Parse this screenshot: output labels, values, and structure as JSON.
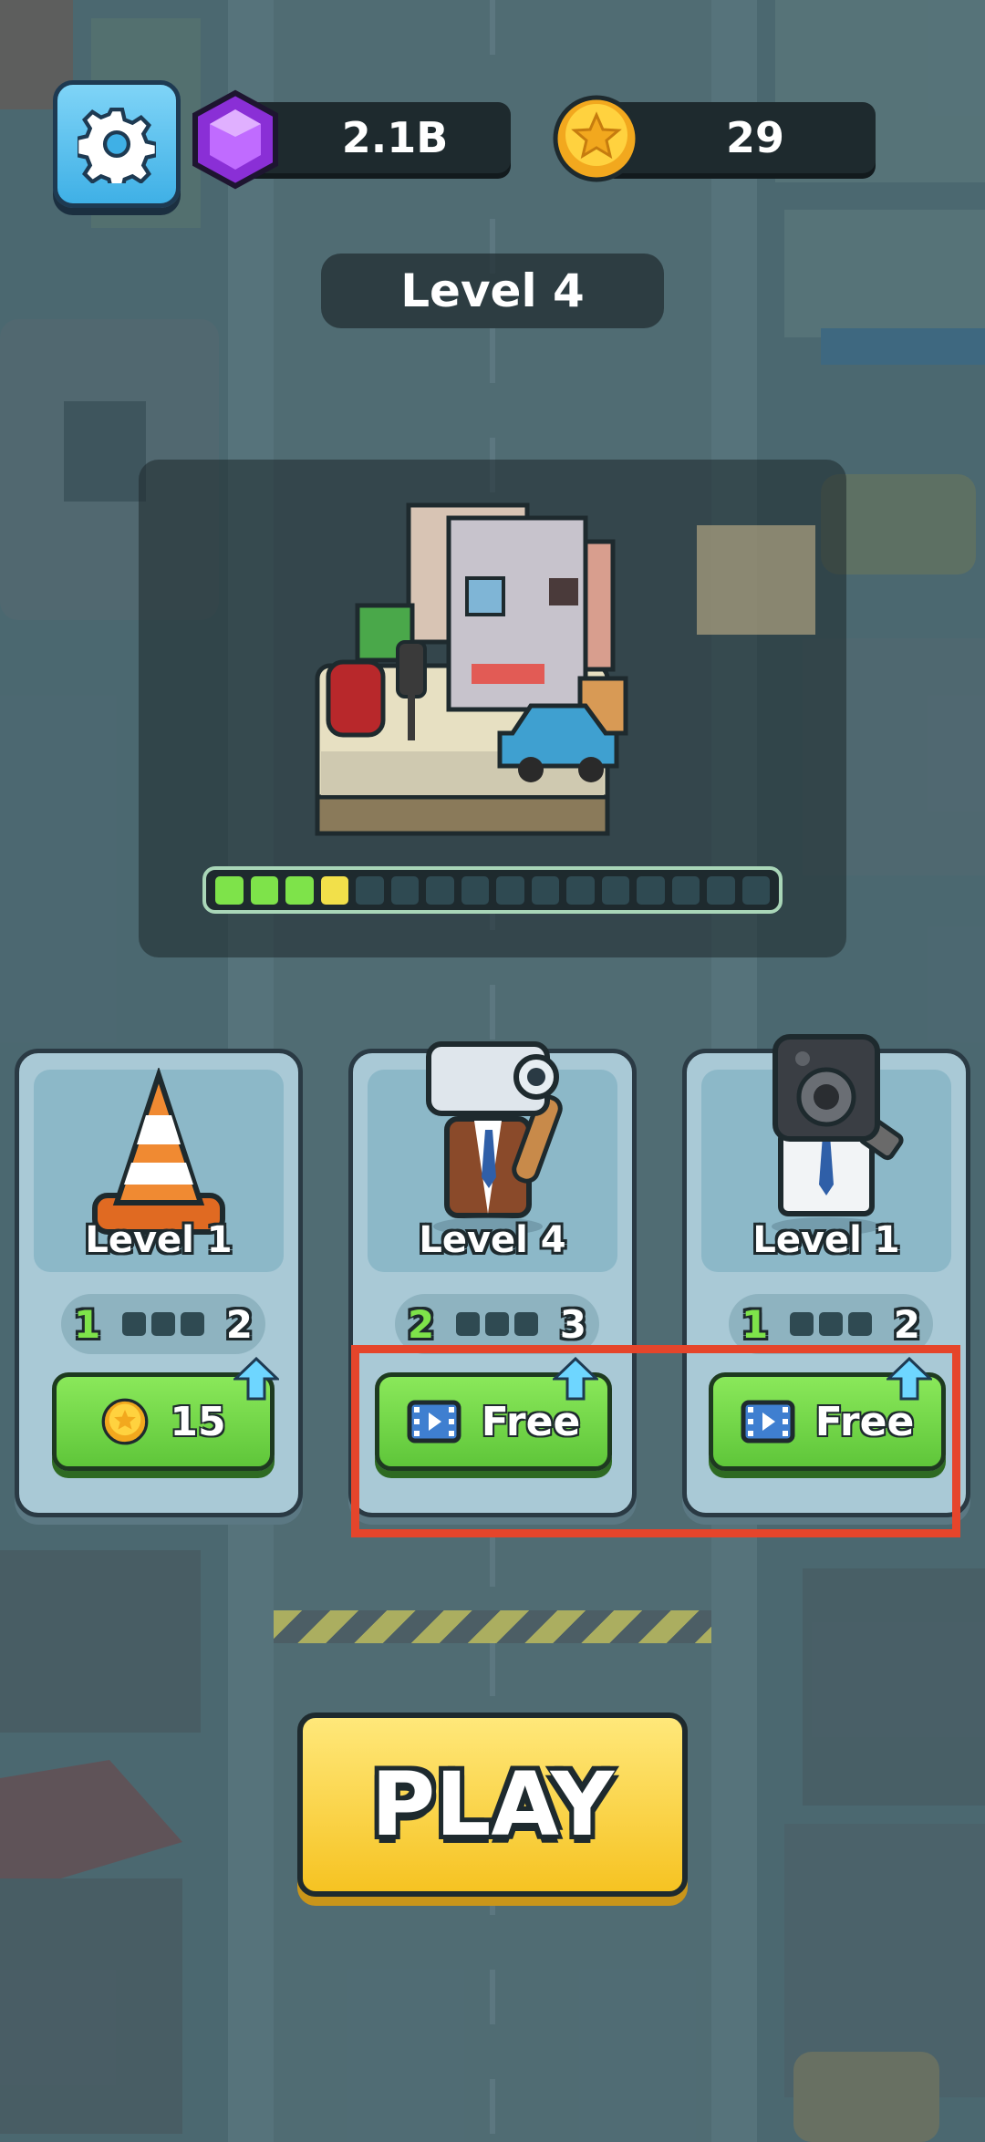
{
  "hud": {
    "gems": "2.1B",
    "coins": "29"
  },
  "level_title": "Level 4",
  "progress": {
    "total_segments": 16,
    "completed": 3,
    "current": 4
  },
  "cards": [
    {
      "name": "traffic-cone",
      "level": "Level  1",
      "from": "1",
      "to": "2",
      "button": "15",
      "button_icon": "coin-icon"
    },
    {
      "name": "cameraman",
      "level": "Level  4",
      "from": "2",
      "to": "3",
      "button": "Free",
      "button_icon": "video-ad-icon"
    },
    {
      "name": "speakerman",
      "level": "Level  1",
      "from": "1",
      "to": "2",
      "button": "Free",
      "button_icon": "video-ad-icon"
    }
  ],
  "play_label": "PLAY",
  "colors": {
    "highlight": "#e5452b",
    "play": "#f6c322",
    "upgrade_button": "#6fd446"
  }
}
